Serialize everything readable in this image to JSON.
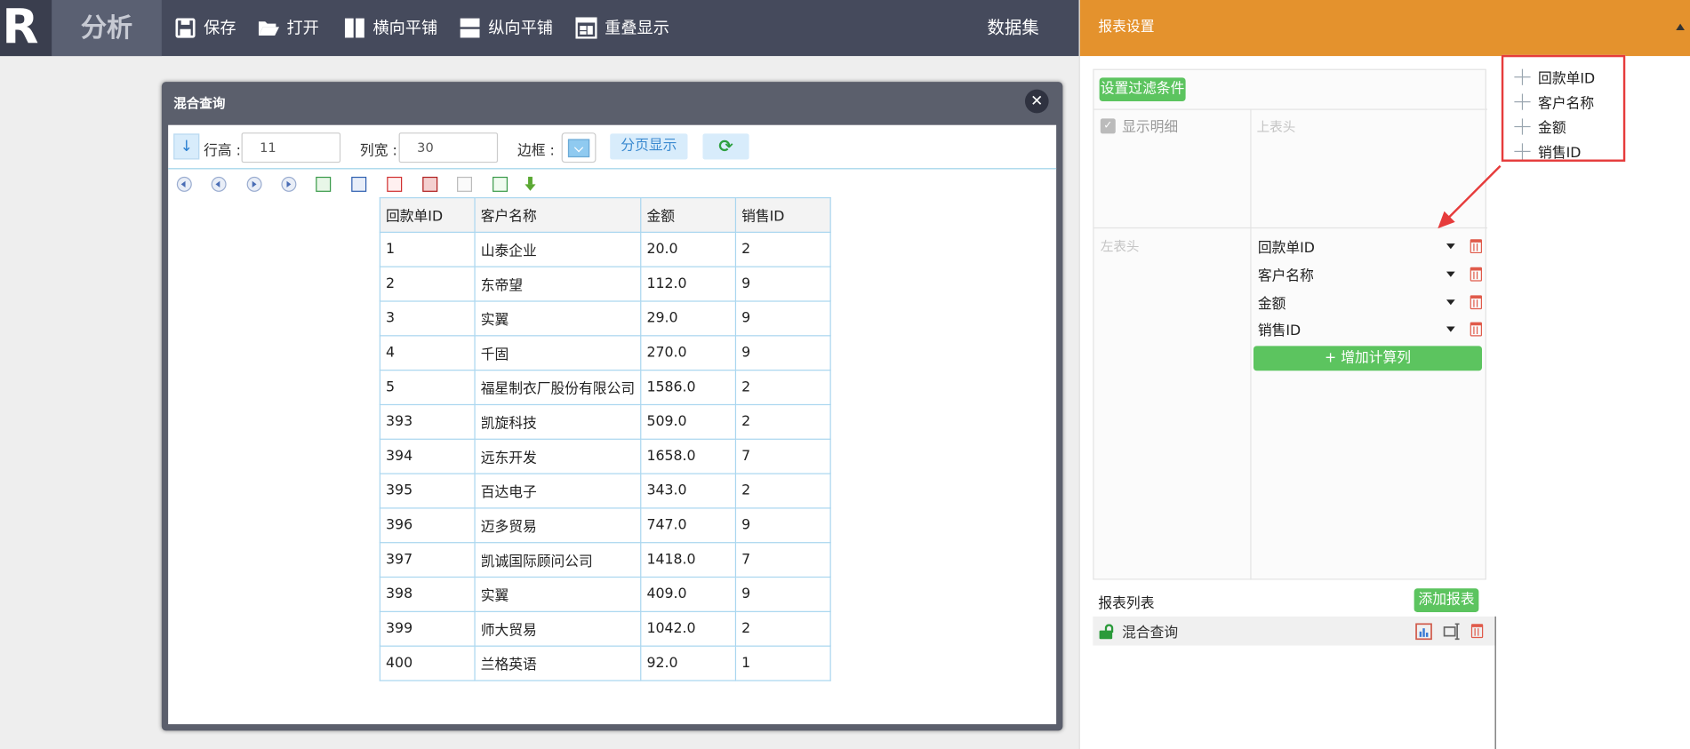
{
  "app": {
    "logo": "R",
    "title": "分析"
  },
  "toolbar": {
    "save": "保存",
    "open": "打开",
    "tile_h": "横向平铺",
    "tile_v": "纵向平铺",
    "overlay": "重叠显示",
    "dataset": "数据集"
  },
  "dialog": {
    "title": "混合查询",
    "row_height_label": "行高 :",
    "row_height_value": "11",
    "col_width_label": "列宽 :",
    "col_width_value": "30",
    "border_label": "边框 :",
    "page_display": "分页显示"
  },
  "table": {
    "headers": [
      "回款单ID",
      "客户名称",
      "金额",
      "销售ID"
    ],
    "rows": [
      [
        "1",
        "山泰企业",
        "20.0",
        "2"
      ],
      [
        "2",
        "东帝望",
        "112.0",
        "9"
      ],
      [
        "3",
        "实翼",
        "29.0",
        "9"
      ],
      [
        "4",
        "千固",
        "270.0",
        "9"
      ],
      [
        "5",
        "福星制衣厂股份有限公司",
        "1586.0",
        "2"
      ],
      [
        "393",
        "凯旋科技",
        "509.0",
        "2"
      ],
      [
        "394",
        "远东开发",
        "1658.0",
        "7"
      ],
      [
        "395",
        "百达电子",
        "343.0",
        "2"
      ],
      [
        "396",
        "迈多贸易",
        "747.0",
        "9"
      ],
      [
        "397",
        "凯诚国际顾问公司",
        "1418.0",
        "7"
      ],
      [
        "398",
        "实翼",
        "409.0",
        "9"
      ],
      [
        "399",
        "师大贸易",
        "1042.0",
        "2"
      ],
      [
        "400",
        "兰格英语",
        "92.0",
        "1"
      ]
    ]
  },
  "settings": {
    "title": "报表设置",
    "filter_button": "设置过滤条件",
    "show_detail": "显示明细",
    "top_header_placeholder": "上表头",
    "left_header_placeholder": "左表头",
    "fields": [
      "回款单ID",
      "客户名称",
      "金额",
      "销售ID"
    ],
    "add_calc": "+ 增加计算列",
    "report_list_title": "报表列表",
    "add_report": "添加报表",
    "reports": [
      {
        "name": "混合查询"
      }
    ]
  },
  "field_list": [
    "回款单ID",
    "客户名称",
    "金额",
    "销售ID"
  ],
  "colors": {
    "accent": "#e4922d",
    "topbar": "#454a5c",
    "green": "#5cc45f",
    "highlight": "#e63b3b"
  }
}
